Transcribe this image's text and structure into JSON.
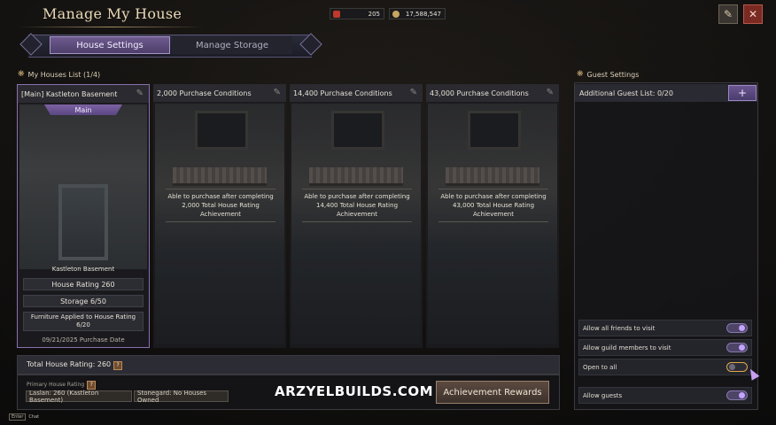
{
  "header": {
    "title": "Manage My House",
    "currency": [
      {
        "icon": "energy-icon",
        "value": "205"
      },
      {
        "icon": "silver-coin-icon",
        "value": "17,588,547"
      }
    ],
    "tabs": [
      {
        "label": "House Settings",
        "active": true
      },
      {
        "label": "Manage Storage",
        "active": false
      }
    ]
  },
  "houses": {
    "heading": "My Houses List (1/4)",
    "main": {
      "name": "[Main] Kastleton Basement",
      "badge": "Main",
      "location": "Kastleton Basement",
      "rating": "House Rating 260",
      "storage": "Storage 6/50",
      "furniture": "Furniture Applied to House Rating 6/20",
      "purchase_date": "09/21/2025 Purchase Date"
    },
    "slots": [
      {
        "title": "2,000 Purchase Conditions",
        "text": "Able to purchase after completing 2,000 Total House Rating Achievement"
      },
      {
        "title": "14,400 Purchase Conditions",
        "text": "Able to purchase after completing 14,400 Total House Rating Achievement"
      },
      {
        "title": "43,000 Purchase Conditions",
        "text": "Able to purchase after completing 43,000 Total House Rating Achievement"
      }
    ],
    "total_rating": "Total House Rating: 260",
    "primary_label": "Primary House Rating",
    "primary_tags": [
      "Laslan: 260 (Kastleton Basement)",
      "Stonegard: No Houses Owned"
    ],
    "achievement_button": "Achievement Rewards"
  },
  "guest": {
    "heading": "Guest Settings",
    "list_label": "Additional Guest List: 0/20",
    "toggles": [
      {
        "label": "Allow all friends to visit",
        "on": true
      },
      {
        "label": "Allow guild members to visit",
        "on": true
      },
      {
        "label": "Open to all",
        "on": false
      },
      {
        "label": "Allow guests",
        "on": true
      }
    ]
  },
  "watermark": "ARZYELBUILDS.COM",
  "footer": {
    "key": "Enter",
    "label": "Chat"
  },
  "colors": {
    "accent": "#6d5a8e",
    "toggle_on": "#c3a3ff",
    "highlight": "#e0a94a"
  }
}
